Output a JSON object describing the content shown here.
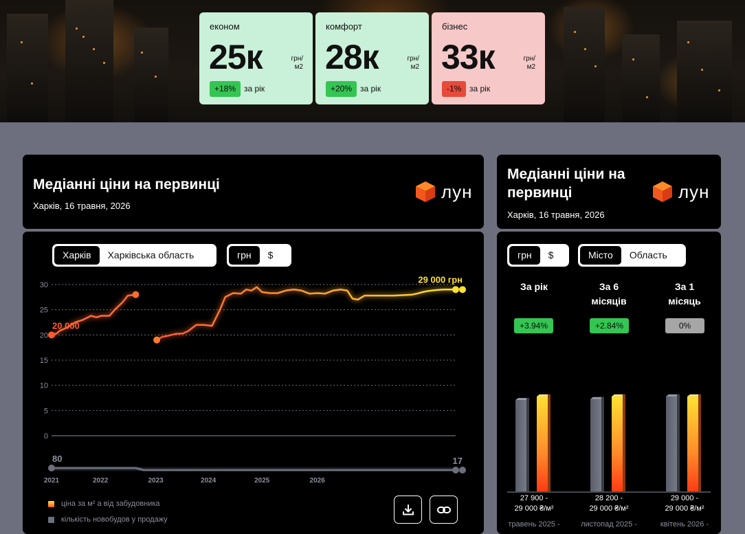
{
  "colors": {
    "econom_card": "#c9f0d8",
    "comfort_card": "#c9f0d8",
    "business_card": "#f6c8c8",
    "up_badge": "#34c552",
    "down_badge": "#e74a3b",
    "neutral_badge": "#a6a6a6",
    "line_start": "#ff5a2e",
    "line_end": "#ffe033",
    "count_line": "#6b6f7c"
  },
  "price_cards": [
    {
      "category": "економ",
      "value": "25к",
      "unit_top": "грн/",
      "unit_bottom": "м2",
      "change": "+18%",
      "period": "за рік",
      "trend": "up"
    },
    {
      "category": "комфорт",
      "value": "28к",
      "unit_top": "грн/",
      "unit_bottom": "м2",
      "change": "+20%",
      "period": "за рік",
      "trend": "up"
    },
    {
      "category": "бізнес",
      "value": "33к",
      "unit_top": "грн/",
      "unit_bottom": "м2",
      "change": "-1%",
      "period": "за рік",
      "trend": "down"
    }
  ],
  "main_panel": {
    "title": "Медіанні ціни на первинці",
    "subtitle": "Харків, 16 травня, 2026",
    "logo_text": "лун",
    "region_toggle": {
      "options": [
        "Харків",
        "Харківська область"
      ],
      "active": 0
    },
    "currency_toggle": {
      "options": [
        "грн",
        "$"
      ],
      "active": 0
    },
    "start_label": "20 000",
    "end_label": "29 000 грн",
    "count_start_label": "80",
    "count_end_label": "17",
    "legend": {
      "price": "ціна за м² а від забудовника",
      "count": "кількість новобудов у продажу"
    },
    "download_icon": "download-icon",
    "link_icon": "link-icon"
  },
  "side_panel": {
    "title_line1": "Медіанні ціни на",
    "title_line2": "первинці",
    "subtitle": "Харків, 16 травня, 2026",
    "logo_text": "лун",
    "currency_toggle": {
      "options": [
        "грн",
        "$"
      ],
      "active": 0
    },
    "area_toggle": {
      "options": [
        "Місто",
        "Область"
      ],
      "active": 0
    },
    "columns": [
      {
        "head_line1": "За рік",
        "head_line2": "",
        "change": "+3.94%",
        "trend": "up",
        "range_line1": "27 900 -",
        "range_line2": "29 000 ₴/м²",
        "period": "травень 2025 -",
        "before": 27900,
        "after": 29000
      },
      {
        "head_line1": "За 6",
        "head_line2": "місяців",
        "change": "+2.84%",
        "trend": "up",
        "range_line1": "28 200 -",
        "range_line2": "29 000 ₴/м²",
        "period": "листопад 2025 -",
        "before": 28200,
        "after": 29000
      },
      {
        "head_line1": "За 1",
        "head_line2": "місяць",
        "change": "0%",
        "trend": "neutral",
        "range_line1": "29 000 -",
        "range_line2": "29 000 ₴/м²",
        "period": "квітень 2026 -",
        "before": 29000,
        "after": 29000
      }
    ]
  },
  "chart_data": {
    "type": "line",
    "y_ticks": [
      "0",
      "5",
      "10",
      "15",
      "20",
      "25",
      "30"
    ],
    "ylim": [
      0,
      30
    ],
    "x_ticks": [
      "2021",
      "2022",
      "2023",
      "2024",
      "2025",
      "2026"
    ],
    "grid": true,
    "series": [
      {
        "name": "ціна за м² а від забудовника",
        "segments": [
          [
            [
              2021.0,
              20.0
            ],
            [
              2021.1,
              20.3
            ],
            [
              2021.15,
              20.8
            ],
            [
              2021.3,
              21.5
            ],
            [
              2021.45,
              22.5
            ],
            [
              2021.6,
              23.0
            ],
            [
              2021.75,
              23.8
            ],
            [
              2021.85,
              23.5
            ],
            [
              2021.95,
              23.8
            ],
            [
              2022.1,
              23.8
            ],
            [
              2022.2,
              25.0
            ],
            [
              2022.35,
              26.5
            ],
            [
              2022.45,
              27.8
            ],
            [
              2022.6,
              28.0
            ]
          ],
          [
            [
              2023.0,
              19.0
            ],
            [
              2023.1,
              19.6
            ],
            [
              2023.2,
              19.8
            ],
            [
              2023.35,
              20.2
            ],
            [
              2023.5,
              20.3
            ],
            [
              2023.6,
              20.8
            ],
            [
              2023.75,
              22.0
            ],
            [
              2023.9,
              22.0
            ],
            [
              2024.05,
              21.8
            ],
            [
              2024.2,
              25.0
            ],
            [
              2024.3,
              27.5
            ],
            [
              2024.45,
              28.3
            ],
            [
              2024.6,
              28.2
            ],
            [
              2024.7,
              29.0
            ],
            [
              2024.8,
              28.8
            ],
            [
              2024.9,
              29.5
            ],
            [
              2025.0,
              28.5
            ],
            [
              2025.15,
              28.3
            ],
            [
              2025.3,
              28.3
            ],
            [
              2025.45,
              28.8
            ],
            [
              2025.6,
              29.0
            ],
            [
              2025.75,
              28.8
            ],
            [
              2025.9,
              28.2
            ],
            [
              2026.05,
              28.3
            ],
            [
              2026.2,
              28.2
            ],
            [
              2026.35,
              28.8
            ],
            [
              2026.5,
              29.0
            ],
            [
              2026.62,
              28.8
            ],
            [
              2026.72,
              27.2
            ],
            [
              2026.82,
              27.0
            ],
            [
              2026.95,
              27.8
            ],
            [
              2027.1,
              27.8
            ],
            [
              2027.3,
              27.8
            ],
            [
              2027.5,
              27.8
            ],
            [
              2027.7,
              27.9
            ],
            [
              2027.85,
              28.0
            ],
            [
              2027.95,
              28.2
            ],
            [
              2028.05,
              28.5
            ],
            [
              2028.15,
              28.7
            ],
            [
              2028.3,
              28.9
            ],
            [
              2028.45,
              29.0
            ],
            [
              2028.6,
              29.0
            ],
            [
              2028.68,
              29.0
            ]
          ]
        ]
      },
      {
        "name": "кількість новобудов у продажу",
        "values": [
          [
            2021.0,
            80
          ],
          [
            2021.5,
            80
          ],
          [
            2022.0,
            80
          ],
          [
            2022.3,
            78
          ],
          [
            2022.6,
            79
          ],
          [
            2022.75,
            17
          ],
          [
            2023.0,
            17
          ],
          [
            2024.0,
            17
          ],
          [
            2025.0,
            17
          ],
          [
            2026.0,
            17
          ],
          [
            2027.0,
            17
          ],
          [
            2028.0,
            17
          ],
          [
            2028.68,
            17
          ]
        ]
      }
    ]
  }
}
